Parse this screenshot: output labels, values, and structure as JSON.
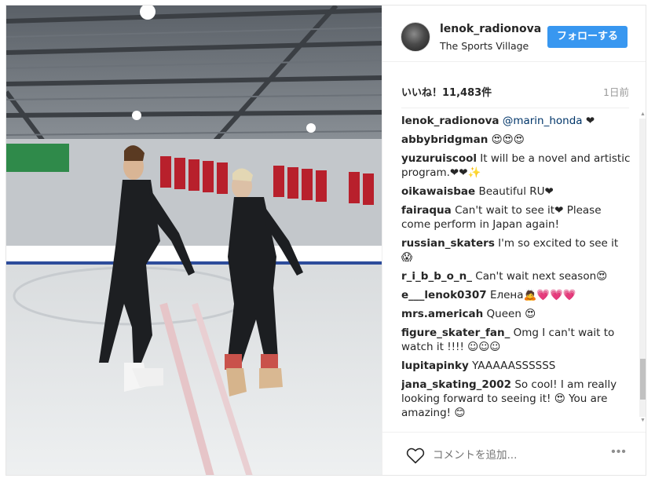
{
  "post": {
    "username": "lenok_radionova",
    "location": "The Sports Village",
    "follow_label": "フォローする",
    "likes": "いいね！11,483件",
    "time_ago": "1日前"
  },
  "comments": [
    {
      "user": "lenok_radionova",
      "text": "@marin_honda ❤"
    },
    {
      "user": "abbybridgman",
      "text": "😍😍😍"
    },
    {
      "user": "yuzuruiscool",
      "text": "It will be a novel and artistic program.❤❤✨"
    },
    {
      "user": "oikawaisbae",
      "text": "Beautiful RU❤"
    },
    {
      "user": "fairaqua",
      "text": "Can't wait to see it❤  Please come perform in Japan again!"
    },
    {
      "user": "russian_skaters",
      "text": "I'm so excited to see it 😱"
    },
    {
      "user": "r_i_b_b_o_n_",
      "text": "Can't wait next season😍"
    },
    {
      "user": "e___lenok0307",
      "text": "Елена🙇💗💗💗"
    },
    {
      "user": "mrs.americah",
      "text": "Queen 😍"
    },
    {
      "user": "figure_skater_fan_",
      "text": "Omg I can't wait to watch it !!!! ☺☺☺"
    },
    {
      "user": "lupitapinky",
      "text": "YAAAAASSSSSS"
    },
    {
      "user": "jana_skating_2002",
      "text": "So cool! I am really looking forward to seeing it! 😍 You are amazing! 😊"
    }
  ],
  "footer": {
    "comment_placeholder": "コメントを追加...",
    "more_label": "•••"
  },
  "icons": {
    "like": "heart-outline-icon",
    "options": "more-options-icon"
  },
  "colors": {
    "follow_button": "#3897f0",
    "text": "#262626",
    "muted": "#999999"
  }
}
